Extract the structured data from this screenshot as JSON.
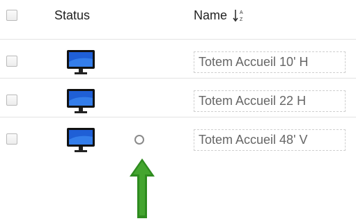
{
  "header": {
    "status_label": "Status",
    "name_label": "Name"
  },
  "rows": [
    {
      "name": "Totem Accueil 10' H",
      "status_icon": "monitor-icon"
    },
    {
      "name": "Totem Accueil 22 H",
      "status_icon": "monitor-icon"
    },
    {
      "name": "Totem Accueil 48' V",
      "status_icon": "monitor-icon",
      "extra_icon": "circle-indicator-icon"
    }
  ],
  "annotation": {
    "icon": "green-arrow-icon",
    "color": "#2e8b1f"
  },
  "colors": {
    "monitor_screen": "#1f5fd6",
    "separator": "#e3e3e3"
  }
}
